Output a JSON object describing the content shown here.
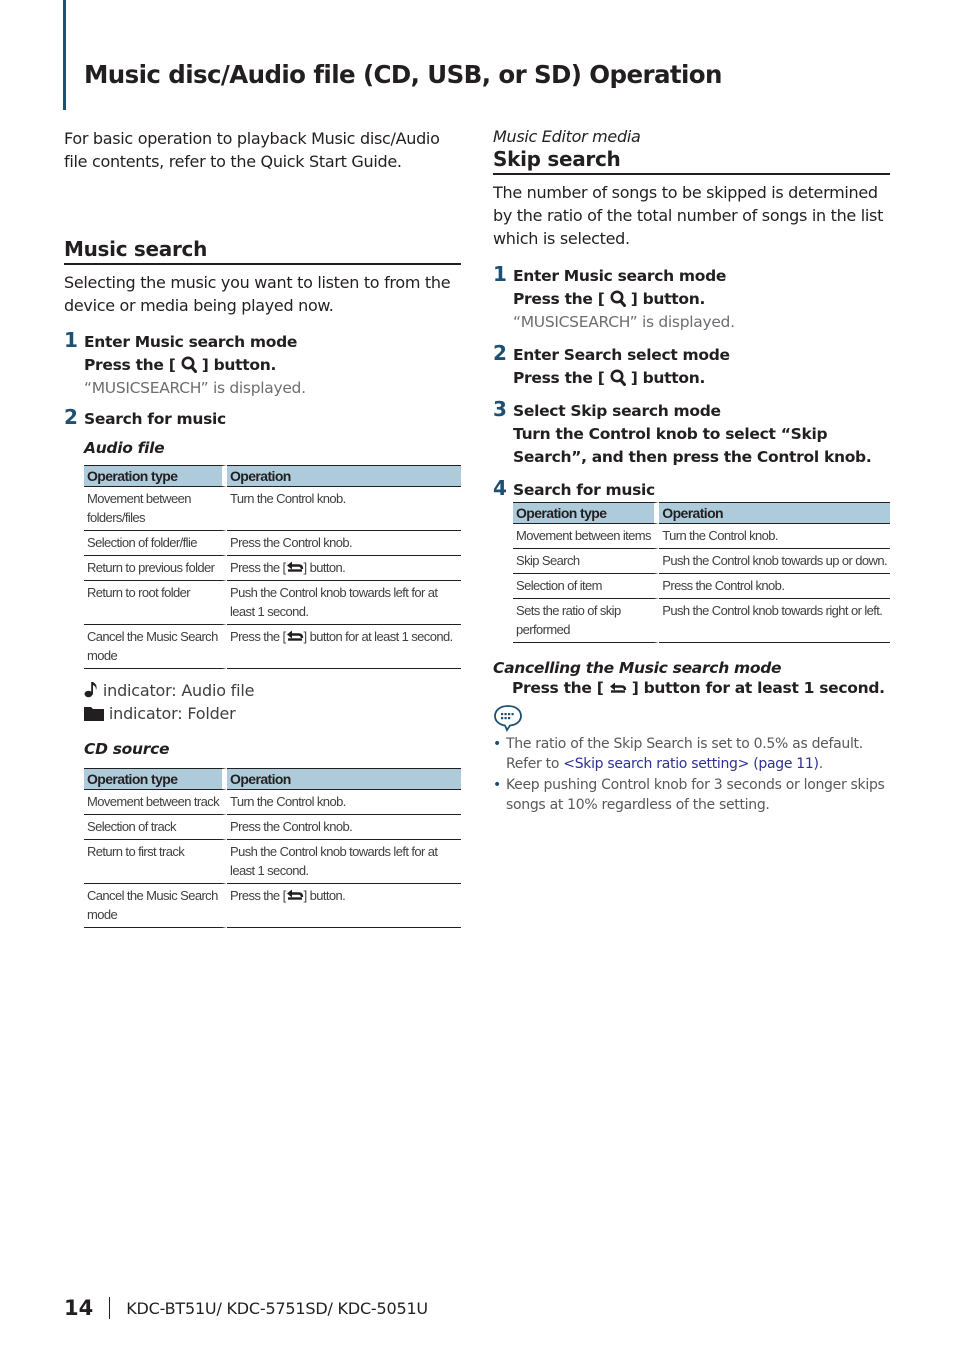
{
  "page": {
    "title": "Music disc/Audio file (CD, USB, or SD) Operation",
    "accent_color": "#1d5073",
    "table_header_color": "#aecbdb",
    "link_color": "#2e3192"
  },
  "left": {
    "intro": "For basic operation to playback Music disc/Audio file contents, refer to the Quick Start Guide.",
    "section_title": "Music search",
    "section_desc": "Selecting the music you want to listen to from the device or media being played now.",
    "steps": [
      {
        "num": "1",
        "title": "Enter Music search mode",
        "action_pre": "Press the [",
        "action_icon": "search-icon",
        "action_post": "] button.",
        "result": "“MUSICSEARCH” is displayed."
      },
      {
        "num": "2",
        "title": "Search for music"
      }
    ],
    "audio_file": {
      "heading": "Audio file",
      "headers": [
        "Operation type",
        "Operation"
      ],
      "rows": [
        {
          "type": "Movement between folders/files",
          "op": "Turn the Control knob."
        },
        {
          "type": "Selection of folder/flie",
          "op": "Press the Control knob."
        },
        {
          "type": "Return to previous folder",
          "op_pre": "Press the [",
          "op_icon": "back-icon",
          "op_post": "] button."
        },
        {
          "type": "Return to root folder",
          "op": "Push the Control knob towards left for at least 1 second."
        },
        {
          "type": "Cancel the Music Search mode",
          "op_pre": "Press the [",
          "op_icon": "back-icon",
          "op_post": "] button for at least 1 second."
        }
      ]
    },
    "indicators": [
      {
        "icon": "music-note-icon",
        "label": "indicator: Audio file"
      },
      {
        "icon": "folder-icon",
        "label": "indicator: Folder"
      }
    ],
    "cd_source": {
      "heading": "CD source",
      "headers": [
        "Operation type",
        "Operation"
      ],
      "rows": [
        {
          "type": "Movement between track",
          "op": "Turn the Control knob."
        },
        {
          "type": "Selection of track",
          "op": "Press the Control knob."
        },
        {
          "type": "Return to first track",
          "op": "Push the Control knob towards left for at least 1 second."
        },
        {
          "type": "Cancel the Music Search mode",
          "op_pre": "Press the [",
          "op_icon": "back-icon",
          "op_post": "] button."
        }
      ]
    }
  },
  "right": {
    "kicker": "Music Editor media",
    "section_title": "Skip search",
    "section_desc": "The number of songs to be skipped is determined by the ratio of the total number of songs in the list which is selected.",
    "steps": [
      {
        "num": "1",
        "title": "Enter Music search mode",
        "action_pre": "Press the [",
        "action_post": "] button.",
        "result": "“MUSICSEARCH” is displayed."
      },
      {
        "num": "2",
        "title": "Enter Search select mode",
        "action_pre": "Press the [",
        "action_post": "] button."
      },
      {
        "num": "3",
        "title": "Select Skip search mode",
        "action": "Turn the Control knob to select “Skip Search”, and then press the Control knob."
      },
      {
        "num": "4",
        "title": "Search for music"
      }
    ],
    "skip_table": {
      "headers": [
        "Operation type",
        "Operation"
      ],
      "rows": [
        {
          "type": "Movement between items",
          "op": "Turn the Control knob."
        },
        {
          "type": "Skip Search",
          "op": "Push the Control knob towards up or down."
        },
        {
          "type": "Selection of item",
          "op": "Press the Control knob."
        },
        {
          "type": "Sets the ratio of skip performed",
          "op": "Push the Control knob towards right or left."
        }
      ]
    },
    "cancel": {
      "heading": "Cancelling the Music search mode",
      "action_pre": "Press the [",
      "action_post": "] button for at least 1 second."
    },
    "notes": [
      {
        "text": "The ratio of the Skip Search is set to 0.5% as default. Refer to ",
        "link": "<Skip search ratio setting> (page 11)",
        "after": "."
      },
      {
        "text": "Keep pushing Control knob for 3 seconds or longer skips songs at 10% regardless of the setting."
      }
    ]
  },
  "footer": {
    "page_number": "14",
    "models": "KDC-BT51U/ KDC-5751SD/ KDC-5051U"
  }
}
